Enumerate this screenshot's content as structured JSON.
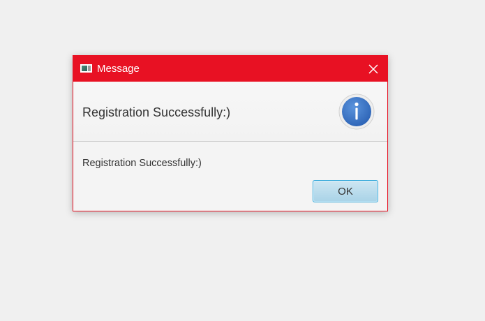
{
  "dialog": {
    "title": "Message",
    "header_text": "Registration Successfully:)",
    "content_text": "Registration Successfully:)",
    "ok_label": "OK",
    "icons": {
      "app": "java-window-icon",
      "close": "close-icon",
      "info": "info-icon"
    },
    "colors": {
      "titlebar": "#e81123",
      "info_icon": "#3b73c4",
      "button": "#a9d3e7"
    }
  }
}
